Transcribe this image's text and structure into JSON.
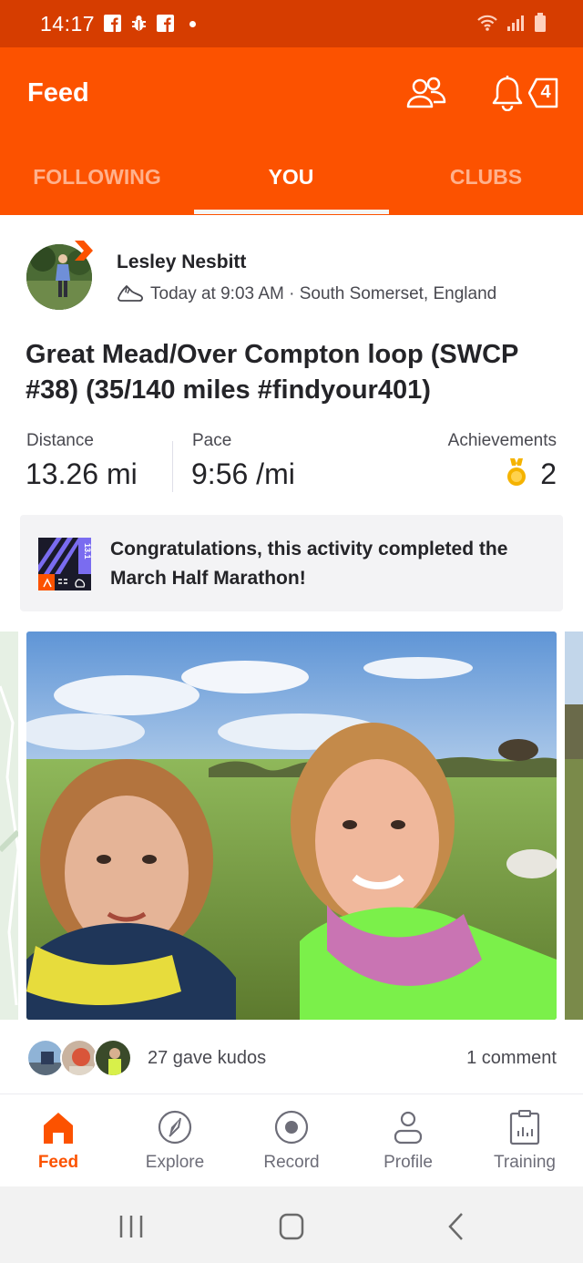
{
  "status_bar": {
    "time": "14:17",
    "notification_icons": [
      "facebook-icon",
      "bug-app-icon",
      "facebook-icon"
    ],
    "system_icons": [
      "wifi-icon",
      "cell-signal-icon",
      "battery-icon"
    ]
  },
  "header": {
    "title": "Feed",
    "notification_count": "4"
  },
  "tabs": [
    {
      "label": "FOLLOWING",
      "active": false
    },
    {
      "label": "YOU",
      "active": true
    },
    {
      "label": "CLUBS",
      "active": false
    }
  ],
  "activity": {
    "athlete_name": "Lesley Nesbitt",
    "meta": "Today at 9:03 AM · South Somerset, England",
    "title": "Great Mead/Over Compton loop (SWCP #38) (35/140 miles #findyour401)",
    "stats": {
      "distance_label": "Distance",
      "distance_value": "13.26 mi",
      "pace_label": "Pace",
      "pace_value": "9:56 /mi",
      "achievements_label": "Achievements",
      "achievements_value": "2"
    },
    "challenge": {
      "badge_text": "13.1",
      "text": "Congratulations, this activity completed the March Half Marathon!"
    },
    "kudos_text": "27 gave kudos",
    "comments_text": "1 comment"
  },
  "bottom_nav": [
    {
      "label": "Feed",
      "icon": "home-icon",
      "active": true
    },
    {
      "label": "Explore",
      "icon": "compass-icon",
      "active": false
    },
    {
      "label": "Record",
      "icon": "record-icon",
      "active": false
    },
    {
      "label": "Profile",
      "icon": "person-icon",
      "active": false
    },
    {
      "label": "Training",
      "icon": "clipboard-chart-icon",
      "active": false
    }
  ],
  "colors": {
    "brand": "#fc5200",
    "status_bar": "#d63d00",
    "inactive_tab": "#ffb18c",
    "medal": "#f5b300"
  }
}
